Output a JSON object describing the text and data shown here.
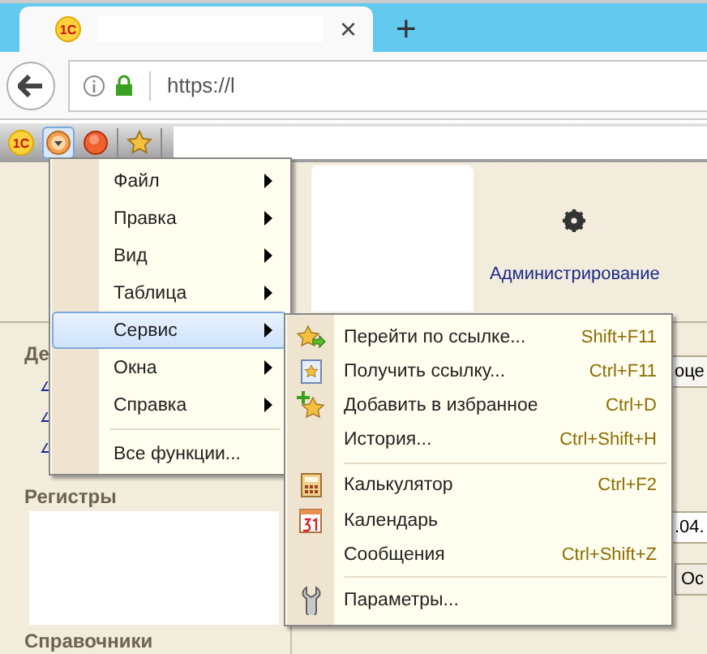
{
  "browser": {
    "tab": {
      "logo": "1С",
      "close": "×"
    },
    "new_tab": "+",
    "address": "https://l"
  },
  "toolbar": {
    "logo": "1С",
    "menu_button": {
      "pressed": true
    }
  },
  "left_panel": {
    "sections": [
      {
        "title": "Де"
      },
      {
        "title": "Регистры"
      },
      {
        "title": "Справочники"
      }
    ]
  },
  "sections_bar": {
    "items": [
      {
        "label": "Администрирование"
      }
    ]
  },
  "right_fragments": {
    "button_1": "оце",
    "field": ".04.",
    "button_2": "Ос"
  },
  "main_menu": {
    "items": [
      {
        "kind": "item",
        "label": "Файл",
        "has_submenu": true,
        "selected": false
      },
      {
        "kind": "item",
        "label": "Правка",
        "has_submenu": true,
        "selected": false
      },
      {
        "kind": "item",
        "label": "Вид",
        "has_submenu": true,
        "selected": false
      },
      {
        "kind": "item",
        "label": "Таблица",
        "has_submenu": true,
        "selected": false
      },
      {
        "kind": "item",
        "label": "Сервис",
        "has_submenu": true,
        "selected": true
      },
      {
        "kind": "item",
        "label": "Окна",
        "has_submenu": true,
        "selected": false
      },
      {
        "kind": "item",
        "label": "Справка",
        "has_submenu": true,
        "selected": false
      },
      {
        "kind": "separator"
      },
      {
        "kind": "item",
        "label": "Все функции...",
        "has_submenu": false,
        "selected": false
      }
    ]
  },
  "submenu": {
    "items": [
      {
        "kind": "item",
        "label": "Перейти по ссылке...",
        "shortcut": "Shift+F11"
      },
      {
        "kind": "item",
        "label": "Получить ссылку...",
        "shortcut": "Ctrl+F11"
      },
      {
        "kind": "item",
        "label": "Добавить в избранное",
        "shortcut": "Ctrl+D"
      },
      {
        "kind": "item",
        "label": "История...",
        "shortcut": "Ctrl+Shift+H"
      },
      {
        "kind": "separator"
      },
      {
        "kind": "item",
        "label": "Калькулятор",
        "shortcut": "Ctrl+F2"
      },
      {
        "kind": "item",
        "label": "Календарь"
      },
      {
        "kind": "item",
        "label": "Сообщения",
        "shortcut": "Ctrl+Shift+Z"
      },
      {
        "kind": "separator"
      },
      {
        "kind": "item",
        "label": "Параметры..."
      }
    ]
  }
}
